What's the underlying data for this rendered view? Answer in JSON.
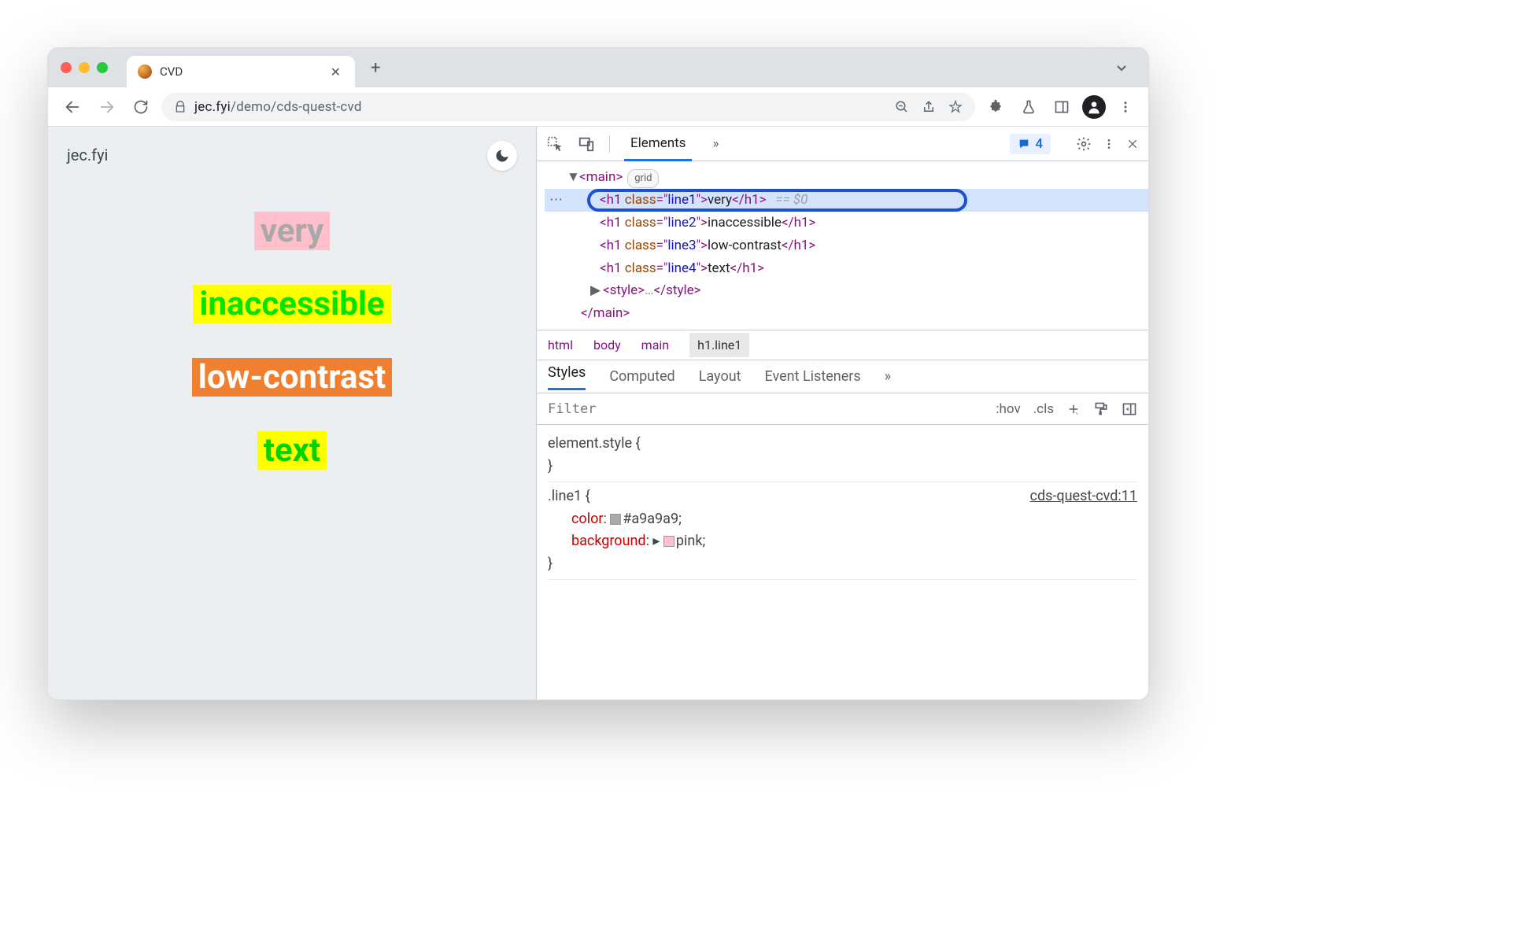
{
  "browser": {
    "tab_title": "CVD",
    "url_host": "jec.fyi",
    "url_path": "/demo/cds-quest-cvd"
  },
  "page": {
    "brand": "jec.fyi",
    "lines": {
      "line1": "very",
      "line2": "inaccessible",
      "line3": "low-contrast",
      "line4": "text"
    }
  },
  "devtools": {
    "active_tab": "Elements",
    "more_marker": "»",
    "issues_count": "4",
    "dom": {
      "main_open": "main",
      "grid_badge": "grid",
      "h1_1": {
        "cls": "line1",
        "txt": "very"
      },
      "h1_2": {
        "cls": "line2",
        "txt": "inaccessible"
      },
      "h1_3": {
        "cls": "line3",
        "txt": "low-contrast"
      },
      "h1_4": {
        "cls": "line4",
        "txt": "text"
      },
      "style_collapsed": "style",
      "main_close": "main",
      "selected_suffix": "== $0"
    },
    "breadcrumbs": [
      "html",
      "body",
      "main",
      "h1.line1"
    ],
    "style_tabs": [
      "Styles",
      "Computed",
      "Layout",
      "Event Listeners"
    ],
    "filter_placeholder": "Filter",
    "filter_tools": {
      "hov": ":hov",
      "cls": ".cls"
    },
    "element_style": "element.style {",
    "rule1": {
      "selector": ".line1 {",
      "source": "cds-quest-cvd:11",
      "p1_name": "color",
      "p1_val": "#a9a9a9",
      "p1_swatch": "#a9a9a9",
      "p2_name": "background",
      "p2_val": "pink",
      "p2_swatch": "#ffc0cb"
    }
  }
}
